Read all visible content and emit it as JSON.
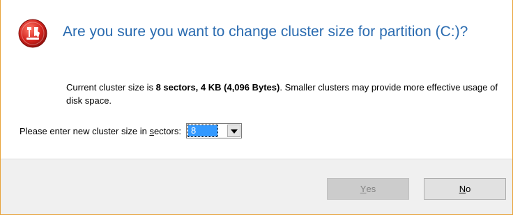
{
  "dialog": {
    "icon": "partition-tool-app-icon",
    "title": "Are you sure you want to change cluster size for partition (C:)?",
    "message": {
      "prefix": "Current cluster size is ",
      "bold": "8 sectors, 4 KB (4,096 Bytes)",
      "suffix": ". Smaller clusters may provide more effective usage of disk space."
    },
    "input": {
      "label_before": "Please enter new cluster size in ",
      "label_underlined": "s",
      "label_after": "ectors:",
      "value": "8"
    },
    "buttons": {
      "yes": {
        "mnemonic": "Y",
        "rest": "es",
        "enabled": false
      },
      "no": {
        "mnemonic": "N",
        "rest": "o",
        "enabled": true
      }
    },
    "colors": {
      "title": "#2a6bb0",
      "border_accent": "#e8a33a",
      "selection": "#3399ff"
    }
  }
}
